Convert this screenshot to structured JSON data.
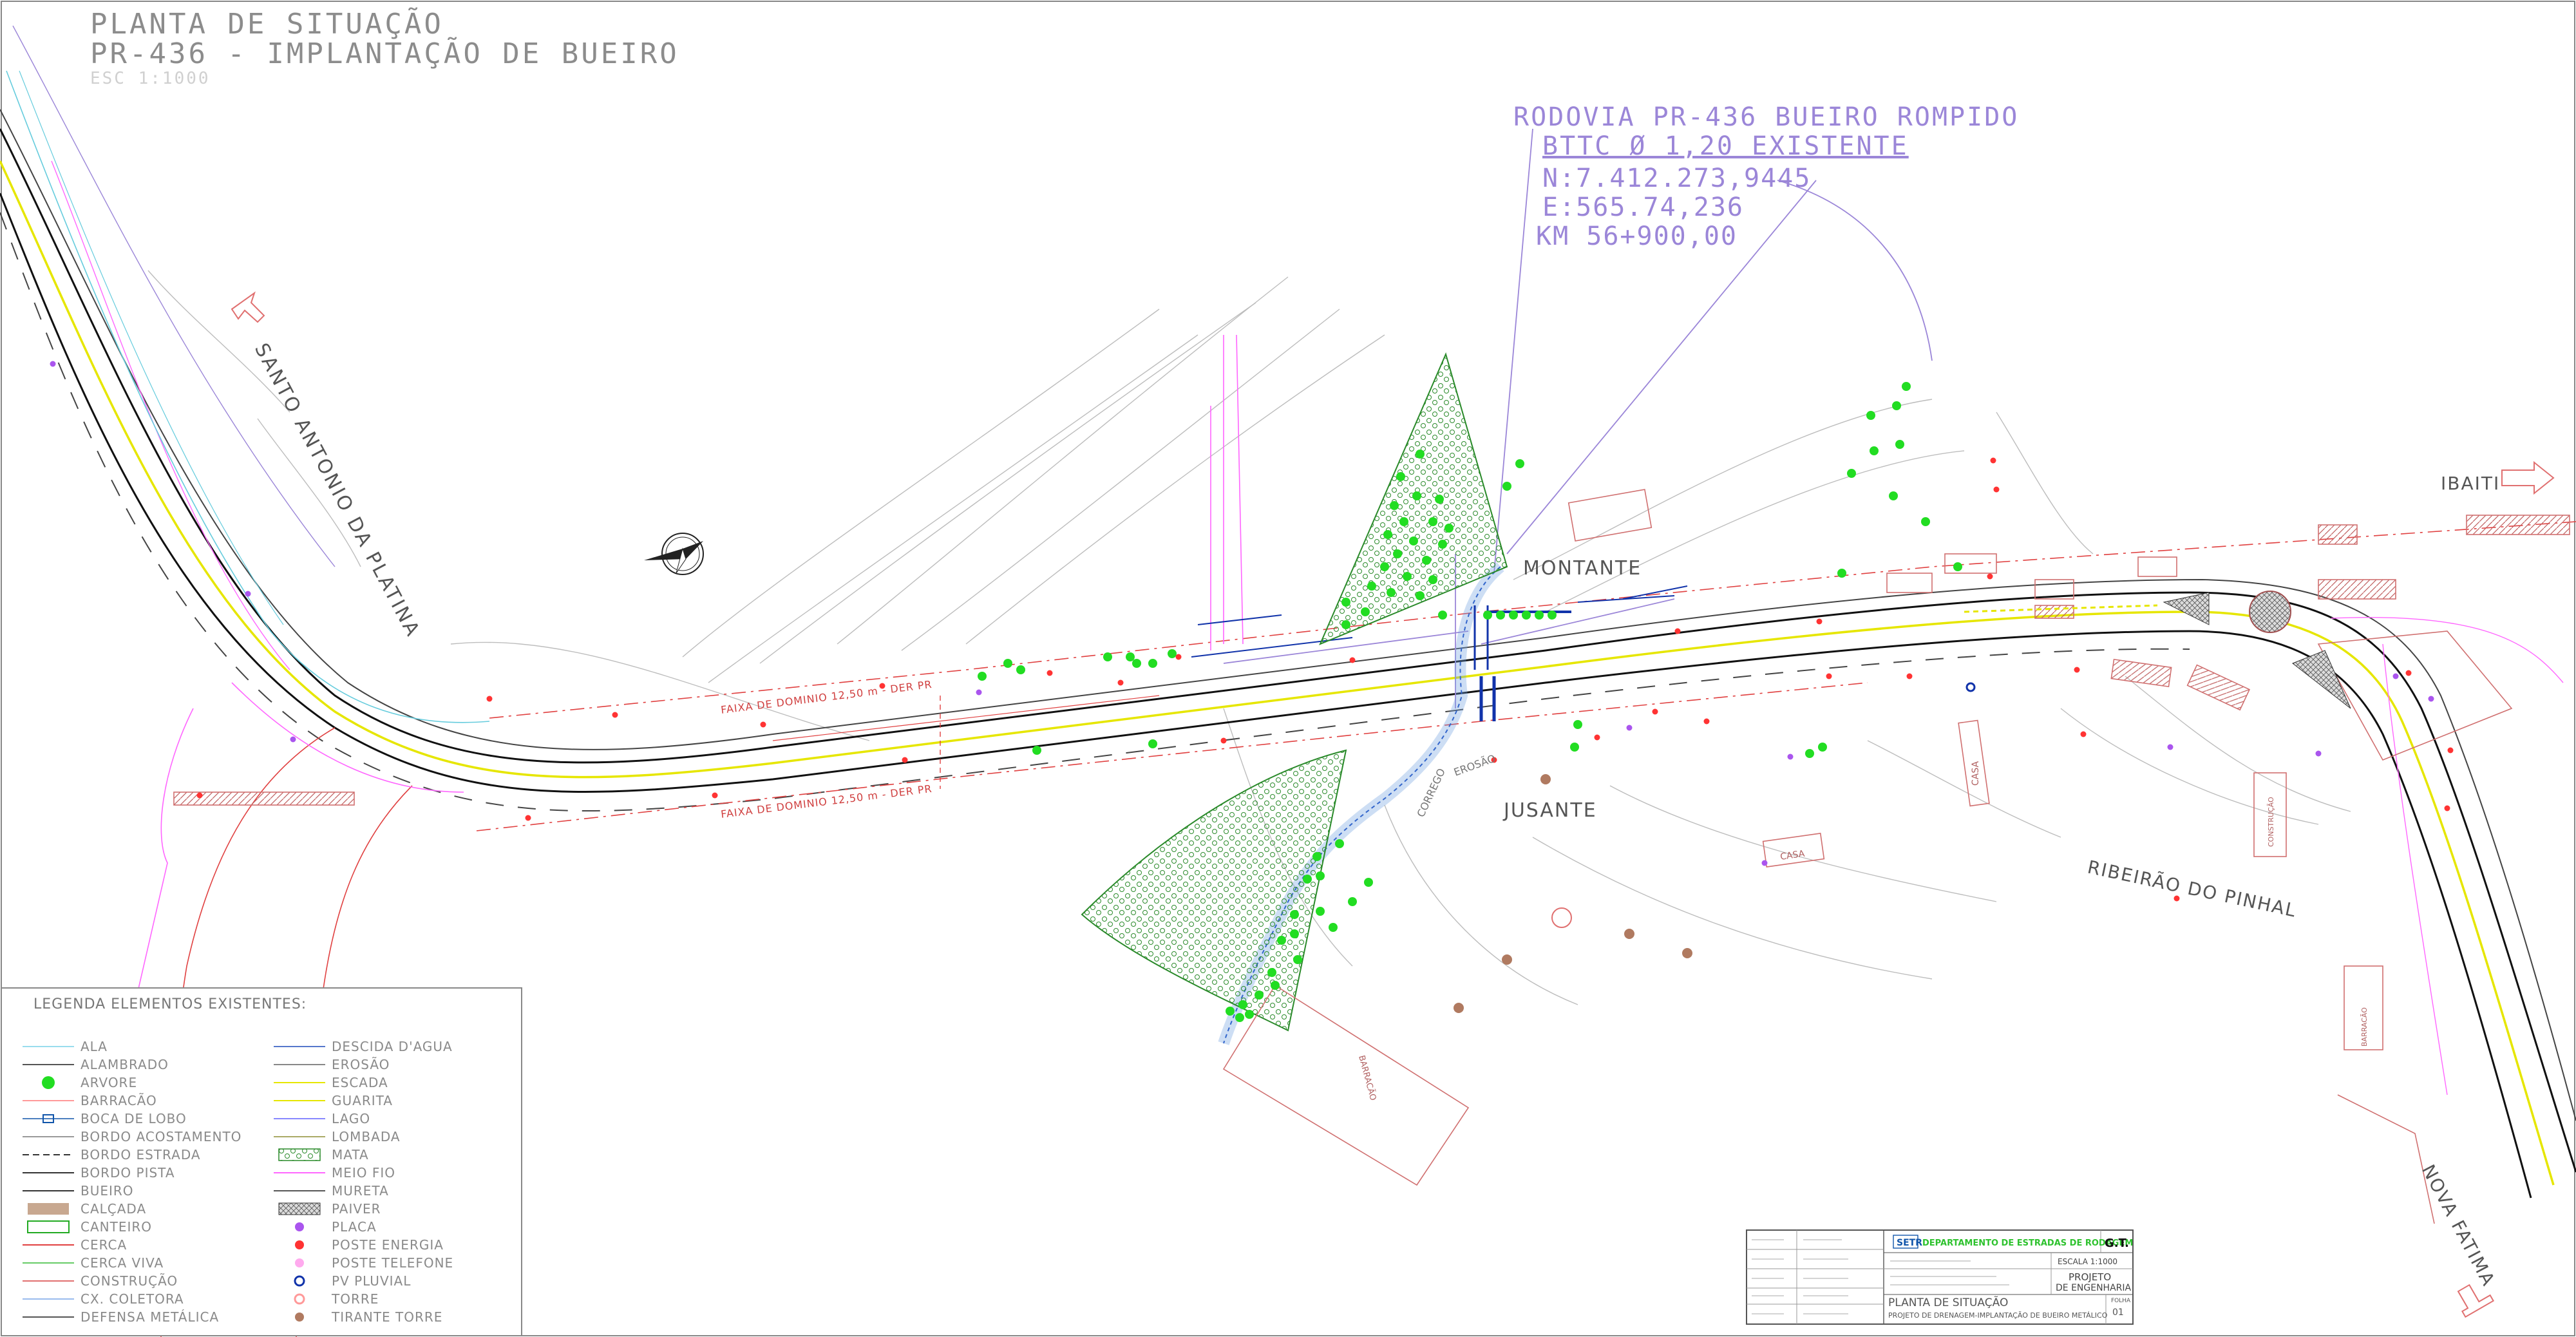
{
  "header": {
    "title_line1": "PLANTA DE SITUAÇÃO",
    "title_line2": "PR-436 - IMPLANTAÇÃO DE BUEIRO",
    "scale": "ESC 1:1000"
  },
  "callout": {
    "line1": "RODOVIA PR-436 BUEIRO ROMPIDO",
    "line2": "BTTC Ø 1,20 EXISTENTE",
    "line3": "N:7.412.273,9445",
    "line4": "E:565.74,236",
    "line5": "KM 56+900,00"
  },
  "places": {
    "santo_antonio": "SANTO ANTONIO DA PLATINA",
    "ibaiti": "IBAITI",
    "nova_fatima": "NOVA FATIMA",
    "ribeirao": "RIBEIRÃO DO PINHAL",
    "montante": "MONTANTE",
    "jusante": "JUSANTE",
    "faixa1": "FAIXA DE DOMINIO 12,50 m - DER PR",
    "faixa2": "FAIXA DE DOMINIO 12,50 m - DER PR",
    "casa1": "CASA",
    "casa2": "CASA",
    "construcao": "CONSTRUÇÃO",
    "barracao1": "BARRACÃO",
    "barracao2": "BARRACÃO",
    "erosao": "EROSÃO",
    "corrego": "CORREGO"
  },
  "legend": {
    "title": "LEGENDA ELEMENTOS EXISTENTES:",
    "col1": [
      "ALA",
      "ALAMBRADO",
      "ARVORE",
      "BARRACÃO",
      "BOCA DE LOBO",
      "BORDO ACOSTAMENTO",
      "BORDO ESTRADA",
      "BORDO PISTA",
      "BUEIRO",
      "CALÇADA",
      "CANTEIRO",
      "CERCA",
      "CERCA VIVA",
      "CONSTRUÇÃO",
      "CX. COLETORA",
      "DEFENSA METÁLICA"
    ],
    "col2": [
      "DESCIDA D'AGUA",
      "EROSÃO",
      "ESCADA",
      "GUARITA",
      "LAGO",
      "LOMBADA",
      "MATA",
      "MEIO FIO",
      "MURETA",
      "PAIVER",
      "PLACA",
      "POSTE ENERGIA",
      "POSTE TELEFONE",
      "PV PLUVIAL",
      "TORRE",
      "TIRANTE TORRE"
    ]
  },
  "title_block": {
    "org": "DEPARTAMENTO DE ESTRADAS DE RODAGEM",
    "setr": "SETR",
    "gt": "G.T.",
    "escala": "ESCALA 1:1000",
    "projeto": "PROJETO",
    "de_engenharia": "DE ENGENHARIA",
    "sheet_title": "PLANTA DE SITUAÇÃO",
    "sheet_sub": "PROJETO DE DRENAGEM-IMPLANTAÇÃO DE BUEIRO METÁLICO",
    "folha_label": "FOLHA",
    "folha": "01"
  },
  "colors": {
    "road": "#111111",
    "centerline": "#e6e600",
    "fence": "#e04040",
    "lilac": "#9b86d8",
    "water": "#3366cc",
    "tree": "#22dd22",
    "magenta": "#ff66ff",
    "mata": "#2a8a2a",
    "construction": "#d07070"
  }
}
